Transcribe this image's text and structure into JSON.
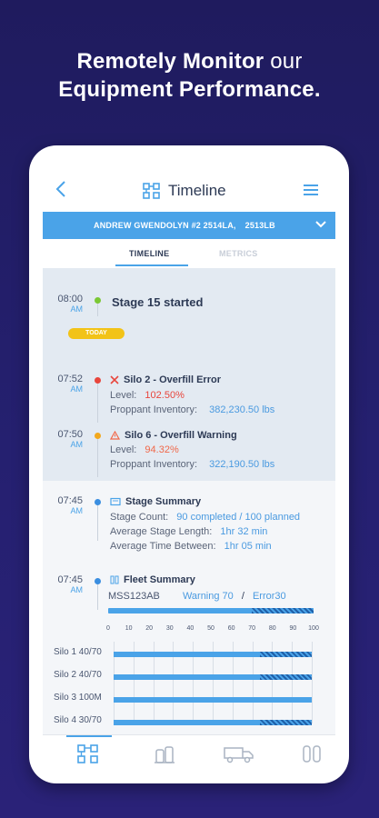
{
  "promo": {
    "line1_bold": "Remotely Monitor",
    "line1_light": " our",
    "line2": "Equipment Performance."
  },
  "header": {
    "title": "Timeline",
    "back_icon": "chevron-left-icon",
    "title_icon": "equipment-grid-icon",
    "menu_icon": "hamburger-menu-icon"
  },
  "well": {
    "name": "ANDREW GWENDOLYN #2 2514LA,",
    "code": "2513LB"
  },
  "tabs": [
    {
      "label": "TIMELINE",
      "active": true
    },
    {
      "label": "METRICS",
      "active": false
    }
  ],
  "today_label": "TODAY",
  "events": {
    "stage": {
      "time": "08:00",
      "ampm": "AM",
      "title": "Stage 15 started",
      "dot_color": "#7bc834"
    },
    "overfill_error": {
      "time": "07:52",
      "ampm": "AM",
      "title": "Silo 2 - Overfill Error",
      "dot_color": "#e8453c",
      "level_label": "Level:",
      "level_value": "102.50%",
      "inventory_label": "Proppant Inventory:",
      "inventory_value": "382,230.50 lbs"
    },
    "overfill_warning": {
      "time": "07:50",
      "ampm": "AM",
      "title": "Silo 6 - Overfill Warning",
      "dot_color": "#f2a81d",
      "level_label": "Level:",
      "level_value": "94.32%",
      "inventory_label": "Proppant Inventory:",
      "inventory_value": "322,190.50 lbs"
    },
    "stage_summary": {
      "time": "07:45",
      "ampm": "AM",
      "title": "Stage Summary",
      "dot_color": "#3a8ee0",
      "count_label": "Stage Count:",
      "count_value": "90 completed / 100 planned",
      "avg_len_label": "Average Stage Length:",
      "avg_len_value": "1hr 32 min",
      "avg_between_label": "Average Time Between:",
      "avg_between_value": "1hr 05 min"
    },
    "fleet_summary": {
      "time": "07:45",
      "ampm": "AM",
      "title": "Fleet Summary",
      "dot_color": "#3a8ee0",
      "unit": "MSS123AB",
      "warning": "Warning 70",
      "separator": "/",
      "error": "Error30"
    }
  },
  "chart_data": {
    "type": "bar",
    "orientation": "horizontal",
    "x_ticks": [
      "0",
      "10",
      "20",
      "30",
      "40",
      "50",
      "60",
      "70",
      "80",
      "90",
      "100"
    ],
    "xlim": [
      0,
      100
    ],
    "fleet_bar": {
      "warning": 70,
      "error": 30
    },
    "categories": [
      "Silo 1",
      "Silo 2",
      "Silo 3",
      "Silo 4"
    ],
    "value_labels": [
      "40/70",
      "40/70",
      "100M",
      "30/70"
    ],
    "solid_values": [
      74,
      74,
      100,
      74
    ],
    "hatched_values": [
      26,
      26,
      0,
      26
    ]
  },
  "colors": {
    "accent": "#4aa3e8",
    "error": "#e8453c",
    "warning": "#f2a81d",
    "today": "#f2c318",
    "background": "#221d68"
  },
  "bottom_nav": [
    {
      "icon": "equipment-grid-icon",
      "active": true
    },
    {
      "icon": "silo-icon",
      "active": false
    },
    {
      "icon": "truck-icon",
      "active": false
    },
    {
      "icon": "tanks-icon",
      "active": false
    }
  ]
}
